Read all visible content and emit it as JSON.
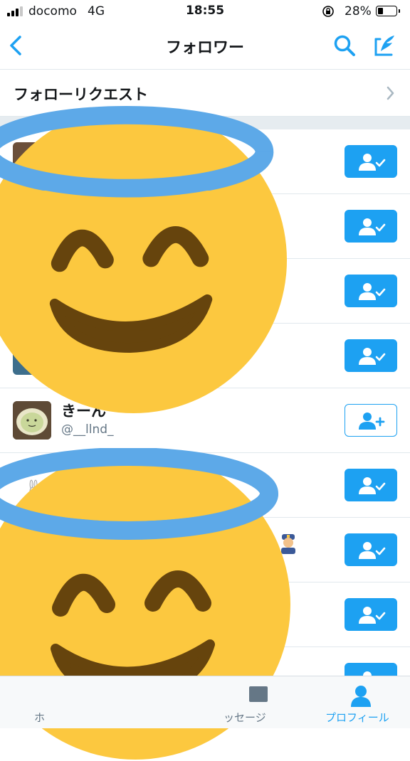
{
  "status_bar": {
    "carrier": "docomo",
    "network": "4G",
    "time": "18:55",
    "battery_percent": "28%",
    "battery_level": 0.28
  },
  "nav": {
    "title": "フォロワー",
    "back_icon": "chevron-left-icon",
    "search_icon": "search-icon",
    "add_icon": "add-follow-icon",
    "accent": "#1da1f2"
  },
  "follow_request": {
    "label": "フォローリクエスト"
  },
  "followers": [
    {
      "name": "",
      "handle": "",
      "following": true
    },
    {
      "name": "",
      "handle": "",
      "following": true
    },
    {
      "name": "",
      "handle": "",
      "following": true
    },
    {
      "name": "",
      "handle": "",
      "following": true
    },
    {
      "name": "きーん",
      "handle": "@__llnd_",
      "following": false
    },
    {
      "name": "",
      "handle": "",
      "following": true
    },
    {
      "name": "",
      "handle": "",
      "following": true
    },
    {
      "name": "",
      "handle": "",
      "following": true
    },
    {
      "name": "",
      "handle": "",
      "following": true
    }
  ],
  "tabbar": {
    "home_label": "ホ",
    "messages_label": "ッセージ",
    "profile_label": "プロフィール",
    "active_tab": "profile"
  },
  "overlays": [
    "smiling-face-with-halo-emoji",
    "smiling-face-with-halo-emoji",
    "police-officer-emoji"
  ]
}
